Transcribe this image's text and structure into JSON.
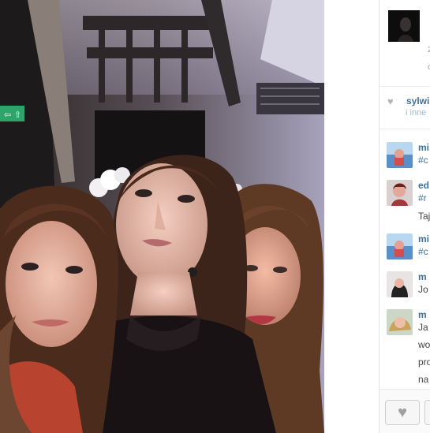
{
  "header": {
    "meta_line_1": "2",
    "meta_line_2": "c"
  },
  "likes": {
    "heart_icon": "heart-icon",
    "user": "sylwi",
    "others": "i inne"
  },
  "comments": [
    {
      "name": "mi",
      "text": "#c",
      "avatar_color": "#5b8fc5"
    },
    {
      "name": "ed",
      "text": "#r",
      "extra": "Taj",
      "avatar_color": "#a03a3a"
    },
    {
      "name": "mi",
      "text": "#c",
      "avatar_color": "#5b8fc5"
    },
    {
      "name": "m",
      "text": "Jo",
      "avatar_color": "#444444"
    },
    {
      "name": "m",
      "text": "Ja",
      "extra_lines": [
        "wo",
        "pro",
        "na"
      ],
      "avatar_color": "#c9a35a"
    }
  ],
  "footer": {
    "like_icon": "heart-icon"
  }
}
